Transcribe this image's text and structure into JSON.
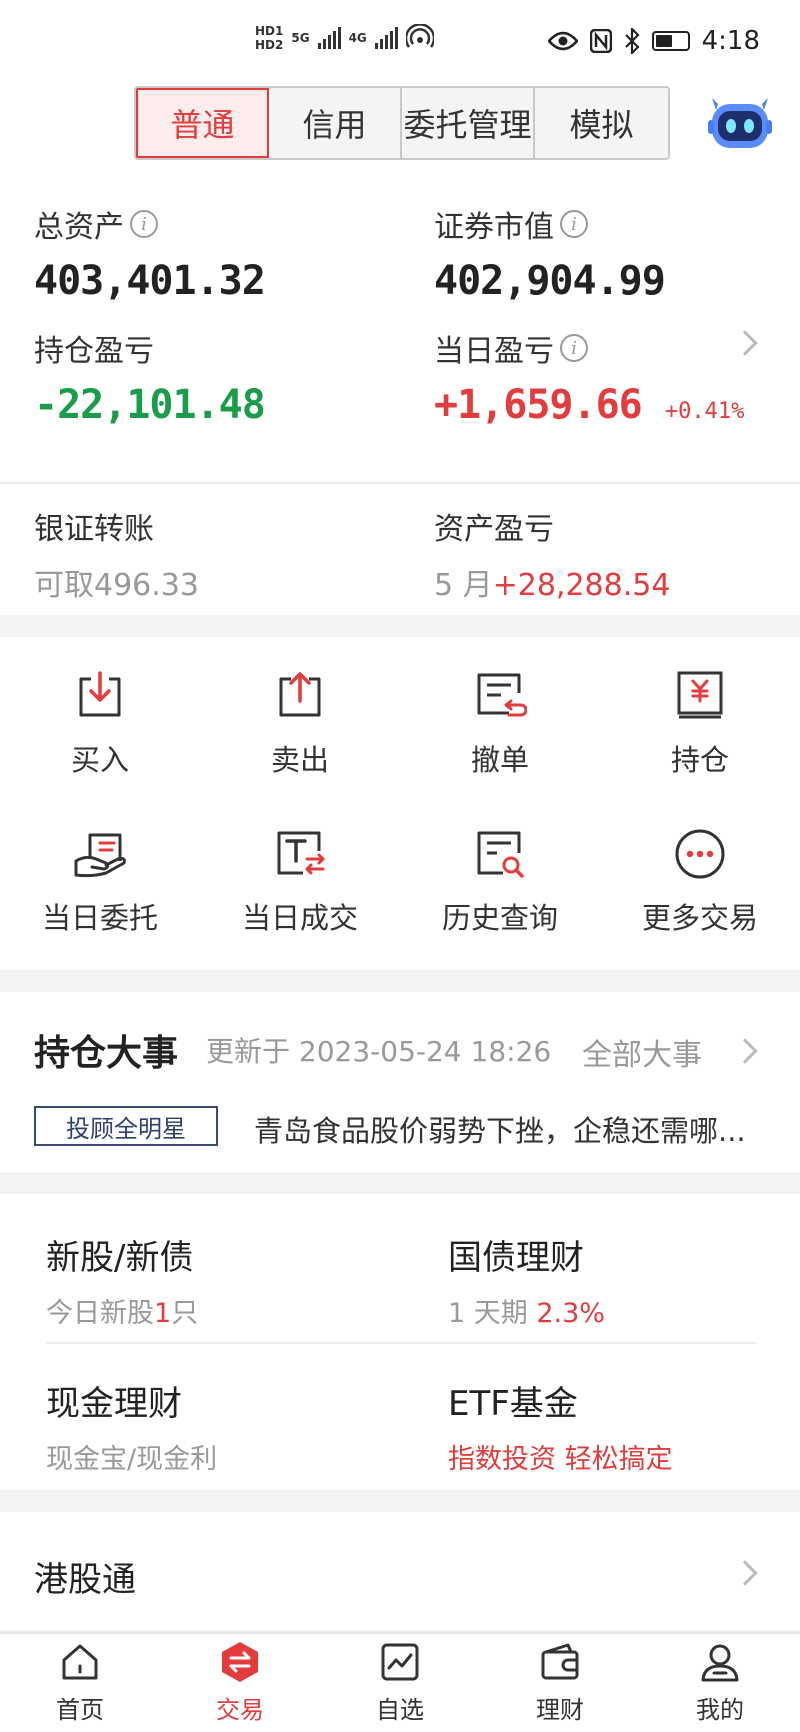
{
  "status_bar": {
    "hd1": "HD1",
    "hd2": "HD2",
    "net5g": "5G",
    "net4g": "4G",
    "time": "4:18"
  },
  "top_tabs": [
    {
      "label": "普通",
      "active": true
    },
    {
      "label": "信用",
      "active": false
    },
    {
      "label": "委托管理",
      "active": false
    },
    {
      "label": "模拟",
      "active": false
    }
  ],
  "assets": {
    "total_assets_label": "总资产",
    "total_assets_value": "403,401.32",
    "market_value_label": "证券市值",
    "market_value_value": "402,904.99",
    "position_pl_label": "持仓盈亏",
    "position_pl_value": "-22,101.48",
    "daily_pl_label": "当日盈亏",
    "daily_pl_value": "+1,659.66",
    "daily_pl_pct": "+0.41%",
    "info_glyph": "i",
    "transfer_label": "银证转账",
    "transfer_prefix": "可取",
    "transfer_value": "496.33",
    "asset_pl_label": "资产盈亏",
    "asset_pl_prefix": "5 月",
    "asset_pl_value": "+28,288.54"
  },
  "actions": [
    {
      "label": "买入",
      "icon": "buy-icon"
    },
    {
      "label": "卖出",
      "icon": "sell-icon"
    },
    {
      "label": "撤单",
      "icon": "cancel-order-icon"
    },
    {
      "label": "持仓",
      "icon": "position-icon"
    },
    {
      "label": "当日委托",
      "icon": "daily-order-icon"
    },
    {
      "label": "当日成交",
      "icon": "daily-deal-icon"
    },
    {
      "label": "历史查询",
      "icon": "history-search-icon"
    },
    {
      "label": "更多交易",
      "icon": "more-icon"
    }
  ],
  "events": {
    "title": "持仓大事",
    "updated": "更新于 2023-05-24 18:26",
    "all_link": "全部大事",
    "tag": "投顾全明星",
    "headline": "青岛食品股价弱势下挫，企稳还需哪..."
  },
  "products": {
    "ipo_title": "新股/新债",
    "ipo_sub_prefix": "今日新股",
    "ipo_sub_count": "1",
    "ipo_sub_suffix": "只",
    "bond_title": "国债理财",
    "bond_sub_prefix": "1 天期",
    "bond_sub_rate": "2.3%",
    "cash_title": "现金理财",
    "cash_sub": "现金宝/现金利",
    "etf_title": "ETF基金",
    "etf_sub": "指数投资 轻松搞定"
  },
  "hk": {
    "title": "港股通"
  },
  "tabbar": [
    {
      "label": "首页",
      "icon": "home-icon",
      "active": false
    },
    {
      "label": "交易",
      "icon": "trade-icon",
      "active": true
    },
    {
      "label": "自选",
      "icon": "watchlist-icon",
      "active": false
    },
    {
      "label": "理财",
      "icon": "wallet-icon",
      "active": false
    },
    {
      "label": "我的",
      "icon": "profile-icon",
      "active": false
    }
  ],
  "colors": {
    "accent_red": "#e23c3c",
    "gain_green": "#1a9c4a"
  }
}
